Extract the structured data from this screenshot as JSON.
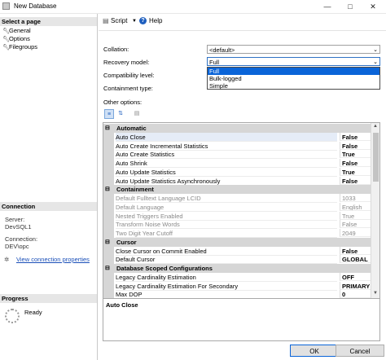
{
  "window": {
    "title": "New Database"
  },
  "left_panel": {
    "select_page_header": "Select a page",
    "pages": [
      {
        "label": "General",
        "icon": "wrench-icon"
      },
      {
        "label": "Options",
        "icon": "wrench-icon"
      },
      {
        "label": "Filegroups",
        "icon": "wrench-icon"
      }
    ],
    "connection_header": "Connection",
    "server_label": "Server:",
    "server_value": "DevSQL1",
    "connection_label": "Connection:",
    "connection_value": "DEV\\opc",
    "view_properties_link": "View connection properties",
    "progress_header": "Progress",
    "progress_status": "Ready"
  },
  "toolbar": {
    "script_label": "Script",
    "help_label": "Help"
  },
  "form": {
    "collation_label": "Collation:",
    "collation_value": "<default>",
    "recovery_label": "Recovery model:",
    "recovery_value": "Full",
    "recovery_options": [
      "Full",
      "Bulk-logged",
      "Simple"
    ],
    "compat_label": "Compatibility level:",
    "containment_label": "Containment type:",
    "other_options_label": "Other options:"
  },
  "grid": {
    "rows": [
      {
        "type": "category",
        "name": "Automatic"
      },
      {
        "type": "prop",
        "name": "Auto Close",
        "value": "False",
        "bold": true,
        "selected": true
      },
      {
        "type": "prop",
        "name": "Auto Create Incremental Statistics",
        "value": "False",
        "bold": true
      },
      {
        "type": "prop",
        "name": "Auto Create Statistics",
        "value": "True",
        "bold": true
      },
      {
        "type": "prop",
        "name": "Auto Shrink",
        "value": "False",
        "bold": true
      },
      {
        "type": "prop",
        "name": "Auto Update Statistics",
        "value": "True",
        "bold": true
      },
      {
        "type": "prop",
        "name": "Auto Update Statistics Asynchronously",
        "value": "False",
        "bold": true
      },
      {
        "type": "category",
        "name": "Containment"
      },
      {
        "type": "prop",
        "name": "Default Fulltext Language LCID",
        "value": "1033",
        "disabled": true
      },
      {
        "type": "prop",
        "name": "Default Language",
        "value": "English",
        "disabled": true
      },
      {
        "type": "prop",
        "name": "Nested Triggers Enabled",
        "value": "True",
        "disabled": true
      },
      {
        "type": "prop",
        "name": "Transform Noise Words",
        "value": "False",
        "disabled": true
      },
      {
        "type": "prop",
        "name": "Two Digit Year Cutoff",
        "value": "2049",
        "disabled": true
      },
      {
        "type": "category",
        "name": "Cursor"
      },
      {
        "type": "prop",
        "name": "Close Cursor on Commit Enabled",
        "value": "False",
        "bold": true
      },
      {
        "type": "prop",
        "name": "Default Cursor",
        "value": "GLOBAL",
        "bold": true
      },
      {
        "type": "category",
        "name": "Database Scoped Configurations"
      },
      {
        "type": "prop",
        "name": "Legacy Cardinality Estimation",
        "value": "OFF",
        "bold": true
      },
      {
        "type": "prop",
        "name": "Legacy Cardinality Estimation For Secondary",
        "value": "PRIMARY",
        "bold": true
      },
      {
        "type": "prop",
        "name": "Max DOP",
        "value": "0",
        "bold": true
      }
    ]
  },
  "description": {
    "title": "Auto Close"
  },
  "buttons": {
    "ok": "OK",
    "cancel": "Cancel"
  }
}
